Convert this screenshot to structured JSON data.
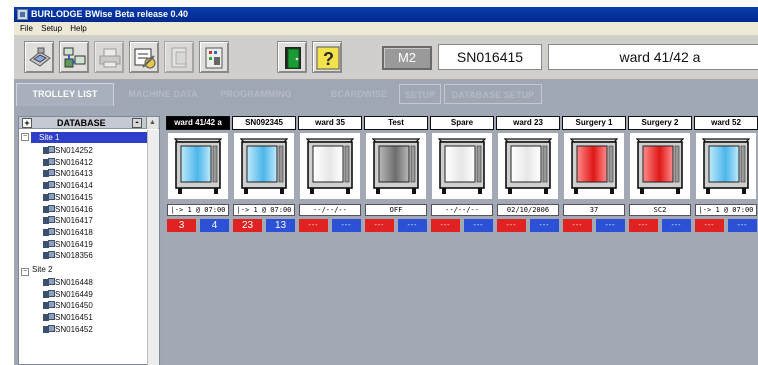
{
  "window": {
    "title": "BURLODGE BWise Beta release 0.40"
  },
  "menu": [
    "File",
    "Setup",
    "Help"
  ],
  "toolbar": {
    "buttons": [
      {
        "name": "machine-icon"
      },
      {
        "name": "network-icon"
      },
      {
        "name": "printer-icon"
      },
      {
        "name": "settings-icon"
      },
      {
        "name": "document-icon"
      },
      {
        "name": "card-icon"
      },
      {
        "name": "exit-door-icon"
      },
      {
        "name": "help-icon"
      }
    ],
    "machine_code": "M2",
    "serial": "SN016415",
    "ward": "ward 41/42 a"
  },
  "tabs": [
    {
      "label": "TROLLEY LIST",
      "active": true
    },
    {
      "label": "MACHINE DATA",
      "active": false
    },
    {
      "label": "PROGRAMMING",
      "active": false
    },
    {
      "label": "BCARDWISE",
      "active": false
    },
    {
      "label": "SETUP",
      "active": false
    },
    {
      "label": "DATABASE SETUP",
      "active": false
    }
  ],
  "tree": {
    "header": "DATABASE",
    "expand_symbol": "+",
    "collapse_symbol": "-",
    "sites": [
      {
        "label": "Site 1",
        "expander": "−",
        "selected": true,
        "devices": [
          "SN014252",
          "SN016412",
          "SN016413",
          "SN016414",
          "SN016415",
          "SN016416",
          "SN016417",
          "SN016418",
          "SN016419",
          "SN018356"
        ]
      },
      {
        "label": "Site 2",
        "expander": "−",
        "selected": false,
        "devices": [
          "SN016448",
          "SN016449",
          "SN016450",
          "SN016451",
          "SN016452"
        ]
      }
    ]
  },
  "trolleys": [
    {
      "name": "ward 41/42 a",
      "selected": true,
      "color": "blue",
      "status": "|-> 1 @ 07:00",
      "red_count": "3",
      "blue_count": "4"
    },
    {
      "name": "SN092345",
      "selected": false,
      "color": "blue",
      "status": "|-> 1 @ 07:00",
      "red_count": "23",
      "blue_count": "13"
    },
    {
      "name": "ward 35",
      "selected": false,
      "color": "white",
      "status": "--/--/--",
      "red_count": "---",
      "blue_count": "---"
    },
    {
      "name": "Test",
      "selected": false,
      "color": "grey",
      "status": "OFF",
      "red_count": "---",
      "blue_count": "---"
    },
    {
      "name": "Spare",
      "selected": false,
      "color": "white",
      "status": "--/--/--",
      "red_count": "---",
      "blue_count": "---"
    },
    {
      "name": "ward 23",
      "selected": false,
      "color": "white",
      "status": "02/10/2006",
      "red_count": "---",
      "blue_count": "---"
    },
    {
      "name": "Surgery 1",
      "selected": false,
      "color": "red",
      "status": "37",
      "red_count": "---",
      "blue_count": "---"
    },
    {
      "name": "Surgery 2",
      "selected": false,
      "color": "red",
      "status": "SC2",
      "red_count": "---",
      "blue_count": "---"
    },
    {
      "name": "ward 52",
      "selected": false,
      "color": "blue",
      "status": "|-> 1 @ 07:00",
      "red_count": "---",
      "blue_count": "---"
    }
  ],
  "colors": {
    "title_bar": "#0a3cad",
    "panel_bg": "#a0a8b5",
    "red_counter": "#e02222",
    "blue_counter": "#2c50d6",
    "tree_selection": "#2e3ec9"
  }
}
